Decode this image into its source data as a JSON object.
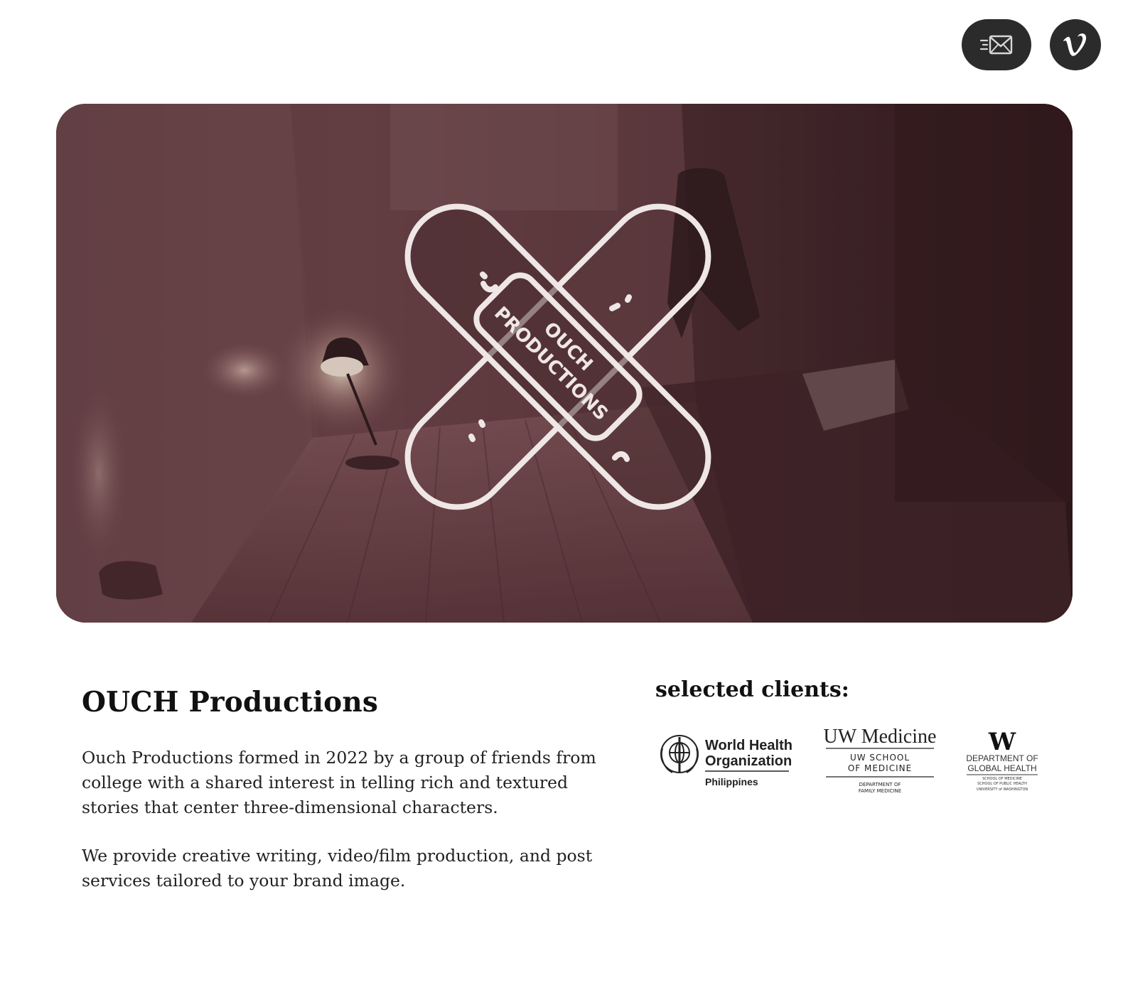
{
  "header": {
    "mail_icon": "mail-send-icon",
    "vimeo_icon": "vimeo-icon"
  },
  "hero": {
    "logo_line1": "OUCH",
    "logo_line2": "PRODUCTIONS"
  },
  "about": {
    "title": "OUCH Productions",
    "paragraph1": "Ouch Productions formed in 2022 by a group of friends from college with a shared interest in telling rich and textured stories that center three-dimensional characters.",
    "paragraph2": "We provide creative writing, video/film production, and post services tailored to your brand image."
  },
  "clients": {
    "heading": "selected clients:",
    "who": {
      "line1": "World Health",
      "line2": "Organization",
      "line3": "Philippines"
    },
    "uw_medicine": {
      "line1": "UW Medicine",
      "line2": "UW SCHOOL",
      "line3": "OF MEDICINE",
      "line4": "DEPARTMENT OF",
      "line5": "FAMILY MEDICINE"
    },
    "global_health": {
      "mark": "W",
      "line1": "DEPARTMENT OF",
      "line2": "GLOBAL HEALTH",
      "line3": "SCHOOL OF MEDICINE",
      "line4": "SCHOOL OF PUBLIC HEALTH",
      "line5": "UNIVERSITY of WASHINGTON"
    }
  },
  "colors": {
    "button_bg": "#2b2b2b",
    "hero_tint": "#4a2c31",
    "logo_stroke": "#efe6e6"
  }
}
